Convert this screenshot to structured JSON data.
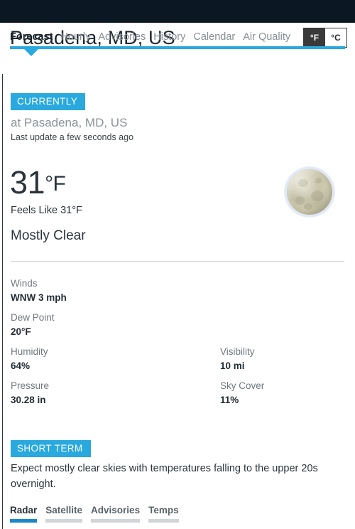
{
  "header": {
    "title": "Pasadena, MD, US",
    "units": [
      {
        "label": "°F",
        "active": true
      },
      {
        "label": "°C",
        "active": false
      }
    ],
    "tabs": [
      {
        "label": "Forecast",
        "active": true
      },
      {
        "label": "Hourly",
        "active": false
      },
      {
        "label": "Advisories",
        "active": false
      },
      {
        "label": "History",
        "active": false
      },
      {
        "label": "Calendar",
        "active": false
      },
      {
        "label": "Air Quality",
        "active": false
      }
    ]
  },
  "currently": {
    "badge": "CURRENTLY",
    "location": "at Pasadena, MD, US",
    "last_update": "Last update a few seconds ago",
    "temperature": "31",
    "temperature_unit": "°F",
    "feels_like": "Feels Like 31°F",
    "condition": "Mostly Clear",
    "icon": "full-moon-icon"
  },
  "details": [
    {
      "label": "Winds",
      "value": "WNW 3 mph"
    },
    {
      "label": "Dew Point",
      "value": "20°F"
    },
    {
      "label": "Humidity",
      "value": "64%"
    },
    {
      "label": "Pressure",
      "value": "30.28 in"
    },
    {
      "label": "Visibility",
      "value": "10 mi"
    },
    {
      "label": "Sky Cover",
      "value": "11%"
    }
  ],
  "short_term": {
    "badge": "SHORT TERM",
    "text": "Expect mostly clear skies with temperatures falling to the upper 20s overnight."
  },
  "bottom_tabs": [
    {
      "label": "Radar",
      "active": true
    },
    {
      "label": "Satellite",
      "active": false
    },
    {
      "label": "Advisories",
      "active": false
    },
    {
      "label": "Temps",
      "active": false
    }
  ],
  "colors": {
    "accent_blue": "#29a9de",
    "active_tab_blue": "#1b87c9",
    "topbar_dark": "#0b1722",
    "text_dark": "#2b343c",
    "text_muted": "#70787f"
  }
}
